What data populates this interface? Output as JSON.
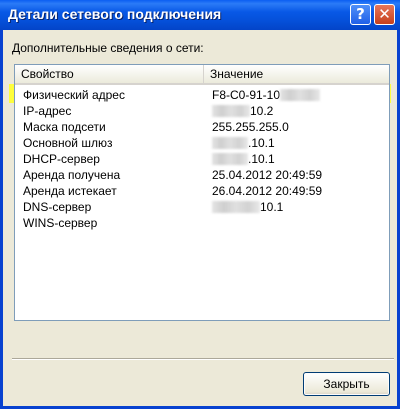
{
  "window": {
    "title": "Детали сетевого подключения",
    "help_glyph": "?",
    "close_glyph": "✕"
  },
  "group_label": "Дополнительные сведения о сети:",
  "columns": {
    "property": "Свойство",
    "value": "Значение"
  },
  "rows": [
    {
      "property": "Физический адрес",
      "value": "F8-C0-91-10",
      "masked": true
    },
    {
      "property": "IP-адрес",
      "value": "10.2",
      "masked": true
    },
    {
      "property": "Маска подсети",
      "value": "255.255.255.0",
      "masked": false
    },
    {
      "property": "Основной шлюз",
      "value": ".10.1",
      "masked": true
    },
    {
      "property": "DHCP-сервер",
      "value": ".10.1",
      "masked": true
    },
    {
      "property": "Аренда получена",
      "value": "25.04.2012 20:49:59",
      "masked": false
    },
    {
      "property": "Аренда истекает",
      "value": "26.04.2012 20:49:59",
      "masked": false
    },
    {
      "property": "DNS-сервер",
      "value": "10.1",
      "masked": true
    },
    {
      "property": "WINS-сервер",
      "value": "",
      "masked": false
    }
  ],
  "buttons": {
    "close": "Закрыть"
  },
  "colors": {
    "titlebar": "#0858e6",
    "highlight": "#ffff33",
    "list_border": "#7f9db9"
  }
}
